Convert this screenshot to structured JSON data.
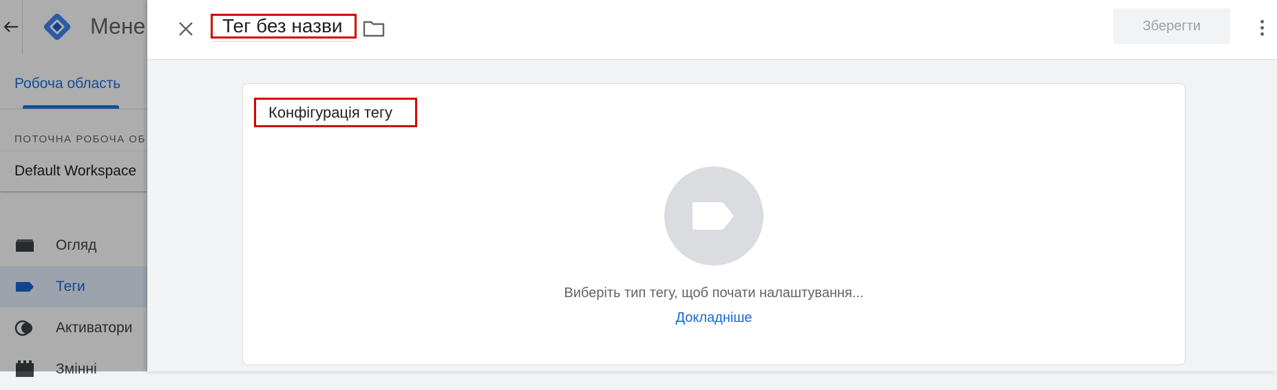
{
  "background": {
    "title": "Мене",
    "workspace_tab": "Робоча область",
    "current_workspace_caption": "ПОТОЧНА РОБОЧА ОБ",
    "workspace_name": "Default Workspace",
    "nav": [
      {
        "label": "Огляд",
        "icon": "folder-icon"
      },
      {
        "label": "Теги",
        "icon": "tag-icon"
      },
      {
        "label": "Активатори",
        "icon": "trigger-icon"
      },
      {
        "label": "Змінні",
        "icon": "variables-icon"
      }
    ]
  },
  "sheet": {
    "tag_name": "Тег без назви",
    "save_label": "Зберегти",
    "card_title": "Конфігурація тегу",
    "hint": "Виберіть тип тегу, щоб почати налаштування...",
    "learn_more": "Докладніше"
  },
  "colors": {
    "accent": "#1a73e8",
    "highlight_border": "#d50000",
    "circle": "#dadce0"
  }
}
